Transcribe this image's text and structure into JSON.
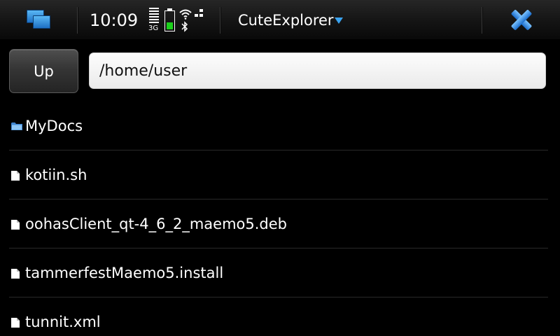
{
  "status_bar": {
    "clock": "10:09",
    "network_type": "3G",
    "battery_color": "#1bd11b",
    "app_title": "CuteExplorer",
    "icons": [
      "task-switcher-icon",
      "signal-strength-icon",
      "battery-icon",
      "wifi-icon",
      "bluetooth-icon",
      "connection-icon",
      "menu-arrow-icon",
      "close-icon"
    ]
  },
  "toolbar": {
    "up_label": "Up",
    "path_value": "/home/user"
  },
  "files": [
    {
      "name": "MyDocs",
      "icon": "folder-icon"
    },
    {
      "name": "kotiin.sh",
      "icon": "file-icon"
    },
    {
      "name": "oohasClient_qt-4_6_2_maemo5.deb",
      "icon": "file-icon"
    },
    {
      "name": "tammerfestMaemo5.install",
      "icon": "file-icon"
    },
    {
      "name": "tunnit.xml",
      "icon": "file-icon"
    }
  ],
  "colors": {
    "accent": "#3aa3f0",
    "background": "#000000"
  }
}
